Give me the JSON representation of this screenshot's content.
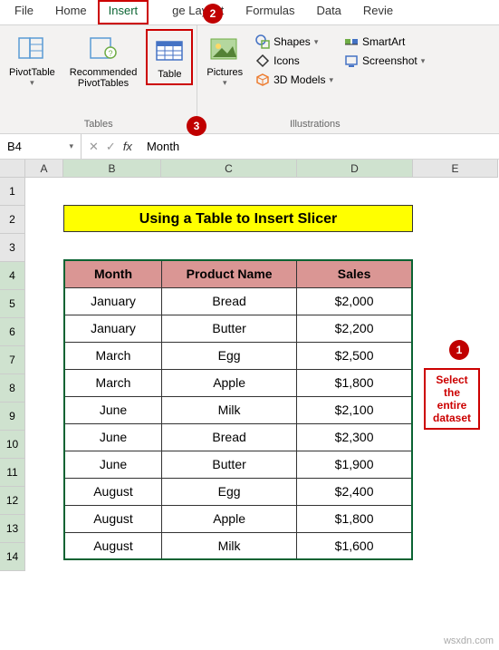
{
  "ribbon": {
    "tabs": [
      "File",
      "Home",
      "Insert",
      "Page Layout",
      "Formulas",
      "Data",
      "Review"
    ],
    "active_tab": "Insert",
    "tables_group": {
      "pivot": "PivotTable",
      "recommended": "Recommended\nPivotTables",
      "table": "Table",
      "label": "Tables"
    },
    "illustrations_group": {
      "pictures": "Pictures",
      "shapes": "Shapes",
      "icons": "Icons",
      "models": "3D Models",
      "smartart": "SmartArt",
      "screenshot": "Screenshot",
      "label": "Illustrations"
    }
  },
  "steps": {
    "s1": "1",
    "s2": "2",
    "s3": "3"
  },
  "name_box": "B4",
  "formula_text": "Month",
  "fx_label": "fx",
  "col_heads": [
    "A",
    "B",
    "C",
    "D",
    "E"
  ],
  "row_heads": [
    "1",
    "2",
    "3",
    "4",
    "5",
    "6",
    "7",
    "8",
    "9",
    "10",
    "11",
    "12",
    "13",
    "14"
  ],
  "title_text": "Using a Table to Insert Slicer",
  "table_headers": [
    "Month",
    "Product Name",
    "Sales"
  ],
  "table_rows": [
    [
      "January",
      "Bread",
      "$2,000"
    ],
    [
      "January",
      "Butter",
      "$2,200"
    ],
    [
      "March",
      "Egg",
      "$2,500"
    ],
    [
      "March",
      "Apple",
      "$1,800"
    ],
    [
      "June",
      "Milk",
      "$2,100"
    ],
    [
      "June",
      "Bread",
      "$2,300"
    ],
    [
      "June",
      "Butter",
      "$1,900"
    ],
    [
      "August",
      "Egg",
      "$2,400"
    ],
    [
      "August",
      "Apple",
      "$1,800"
    ],
    [
      "August",
      "Milk",
      "$1,600"
    ]
  ],
  "annotation": "Select the entire dataset",
  "watermark": "wsxdn.com"
}
